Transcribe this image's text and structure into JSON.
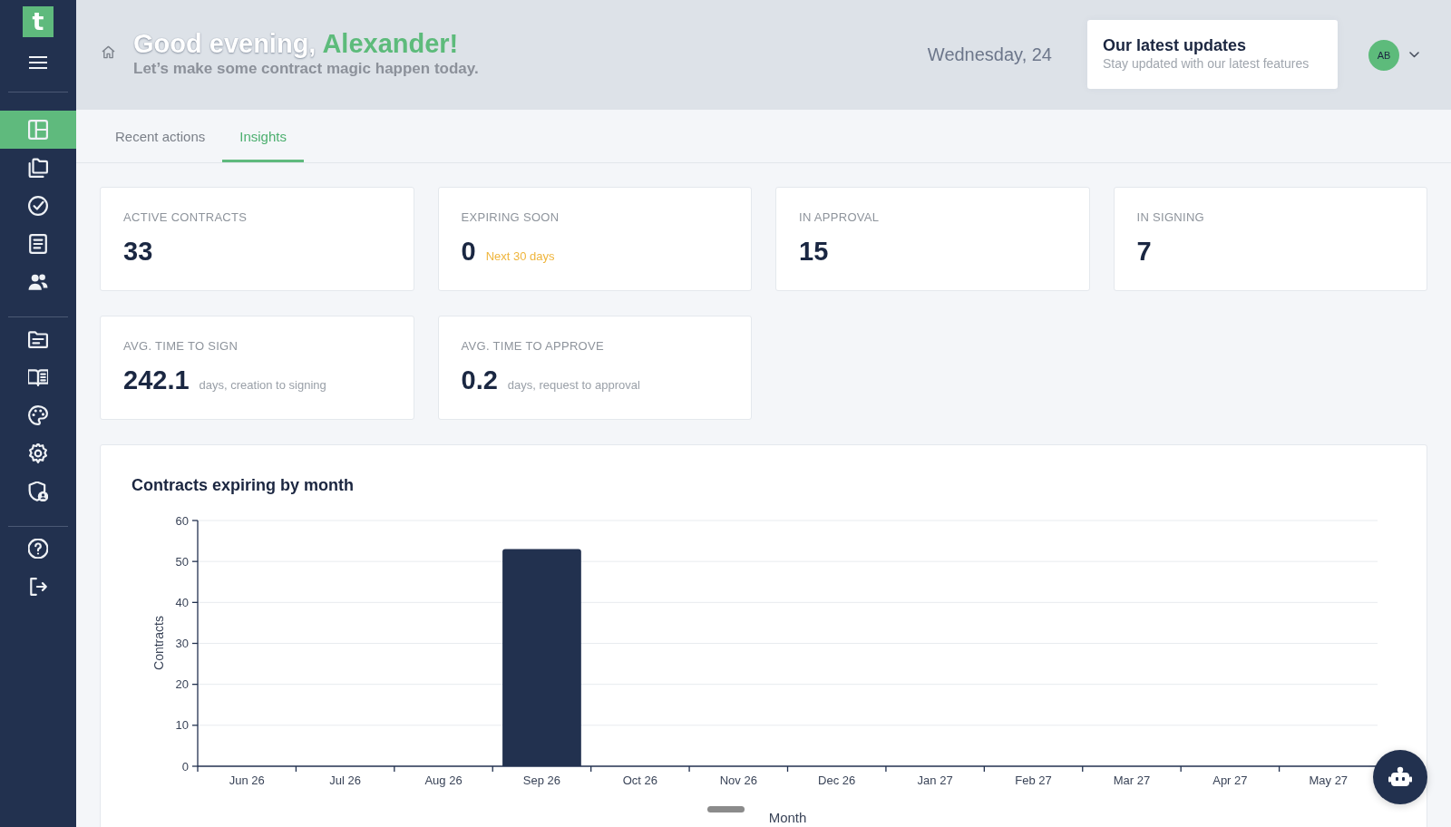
{
  "sidebar": {
    "logo": "t",
    "groups": [
      {
        "items": [
          {
            "selected": true
          },
          {
            "selected": false
          },
          {
            "selected": false
          },
          {
            "selected": false
          },
          {
            "selected": false
          }
        ]
      },
      {
        "items": [
          {
            "selected": false
          },
          {
            "selected": false
          },
          {
            "selected": false
          },
          {
            "selected": false
          },
          {
            "selected": false
          }
        ]
      },
      {
        "items": [
          {
            "selected": false
          },
          {
            "selected": false
          }
        ]
      }
    ]
  },
  "header": {
    "greeting": "Good evening,",
    "user_name": "Alexander!",
    "subtitle": "Let’s make some contract magic happen today.",
    "date": "Wednesday, 24",
    "updates": {
      "title": "Our latest updates",
      "subtitle": "Stay updated with our latest features"
    },
    "avatar": "AB"
  },
  "tabs": [
    {
      "label": "Recent actions",
      "selected": false
    },
    {
      "label": "Insights",
      "selected": true
    }
  ],
  "stats": [
    {
      "label": "ACTIVE CONTRACTS",
      "value": "33"
    },
    {
      "label": "EXPIRING SOON",
      "value": "0",
      "note": {
        "text": "Next 30 days",
        "kind": "warning"
      }
    },
    {
      "label": "IN APPROVAL",
      "value": "15"
    },
    {
      "label": "IN SIGNING",
      "value": "7"
    },
    {
      "label": "AVG. TIME TO SIGN",
      "value": "242.1",
      "note": {
        "text": "days, creation to signing",
        "kind": "unit"
      }
    },
    {
      "label": "AVG. TIME TO APPROVE",
      "value": "0.2",
      "note": {
        "text": "days, request to approval",
        "kind": "unit"
      }
    }
  ],
  "chart_card": {
    "chart_data": {
      "type": "bar",
      "title": "Contracts expiring by month",
      "xlabel": "Month",
      "ylabel": "Contracts",
      "categories": [
        "Jun 26",
        "Jul 26",
        "Aug 26",
        "Sep 26",
        "Oct 26",
        "Nov 26",
        "Dec 26",
        "Jan 27",
        "Feb 27",
        "Mar 27",
        "Apr 27",
        "May 27"
      ],
      "values": [
        0,
        0,
        0,
        53,
        0,
        0,
        0,
        0,
        0,
        0,
        0,
        0
      ],
      "ylim": [
        0,
        60
      ],
      "yticks": [
        0,
        10,
        20,
        30,
        40,
        50,
        60
      ],
      "grid": true
    }
  }
}
